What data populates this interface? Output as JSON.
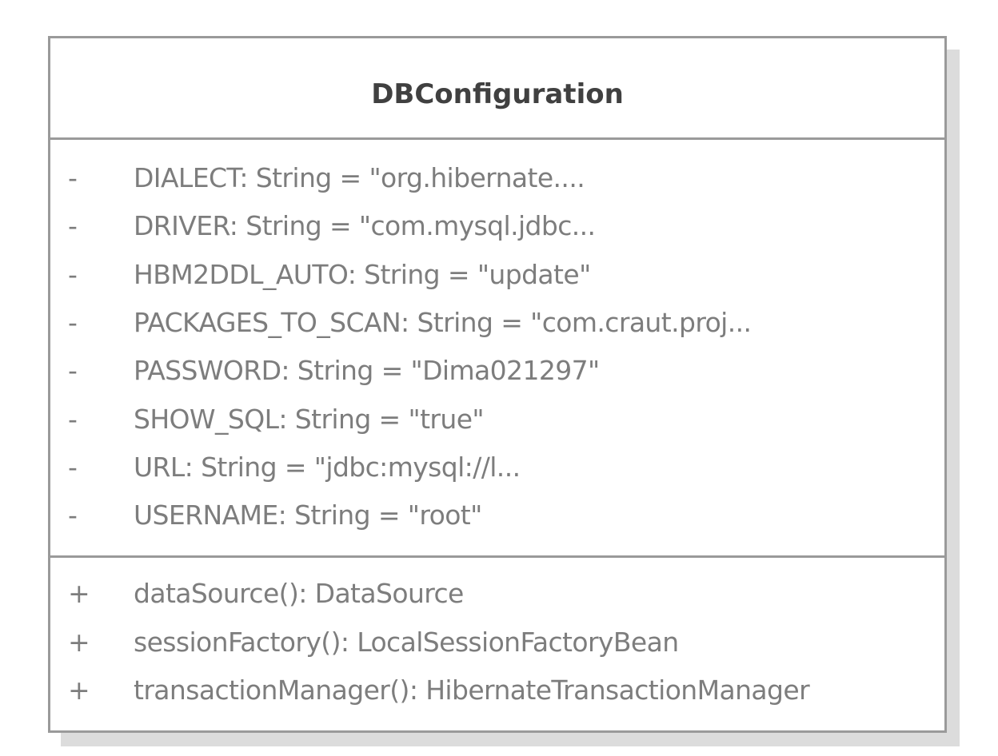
{
  "class_name": "DBConfiguration",
  "attributes": [
    {
      "visibility": "-",
      "text": "DIALECT: String = \"org.hibernate...."
    },
    {
      "visibility": "-",
      "text": "DRIVER: String = \"com.mysql.jdbc..."
    },
    {
      "visibility": "-",
      "text": "HBM2DDL_AUTO: String = \"update\""
    },
    {
      "visibility": "-",
      "text": "PACKAGES_TO_SCAN: String = \"com.craut.proj..."
    },
    {
      "visibility": "-",
      "text": "PASSWORD: String = \"Dima021297\""
    },
    {
      "visibility": "-",
      "text": "SHOW_SQL: String = \"true\""
    },
    {
      "visibility": "-",
      "text": "URL: String = \"jdbc:mysql://l..."
    },
    {
      "visibility": "-",
      "text": "USERNAME: String = \"root\""
    }
  ],
  "operations": [
    {
      "visibility": "+",
      "text": "dataSource(): DataSource"
    },
    {
      "visibility": "+",
      "text": "sessionFactory(): LocalSessionFactoryBean"
    },
    {
      "visibility": "+",
      "text": "transactionManager(): HibernateTransactionManager"
    }
  ],
  "colors": {
    "border": "#9a9a9a",
    "shadow": "#dcdcdc",
    "title_text": "#404040",
    "member_text": "#7d7d7d"
  }
}
